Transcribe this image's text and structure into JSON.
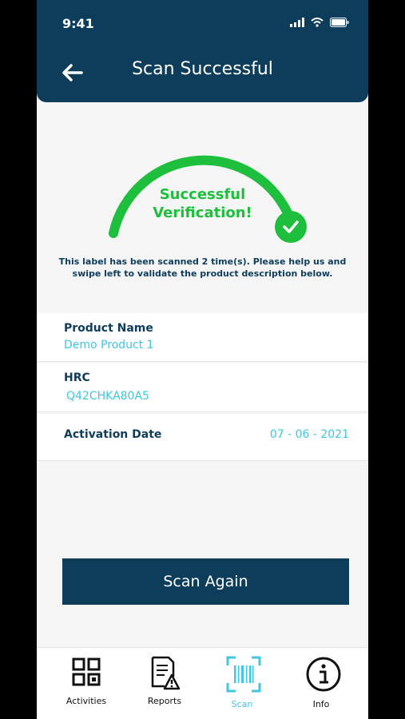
{
  "status_bar": {
    "time": "9:41"
  },
  "header": {
    "title": "Scan Successful"
  },
  "verification": {
    "line1": "Successful",
    "line2": "Verification!",
    "message_line1": "This label has been scanned 2 time(s). Please help us and",
    "message_line2": "swipe left to validate the product description below."
  },
  "fields": {
    "product_name": {
      "label": "Product Name",
      "value": "Demo Product 1"
    },
    "hrc": {
      "label": "HRC",
      "value": "Q42CHKA80A5"
    },
    "activation_date": {
      "label": "Activation Date",
      "value": "07 - 06 - 2021"
    }
  },
  "actions": {
    "scan_again": "Scan Again"
  },
  "tabs": [
    {
      "label": "Activities",
      "icon": "grid-icon"
    },
    {
      "label": "Reports",
      "icon": "report-warning-icon"
    },
    {
      "label": "Scan",
      "icon": "barcode-scan-icon",
      "active": true
    },
    {
      "label": "Info",
      "icon": "info-icon"
    }
  ],
  "colors": {
    "primary": "#0e3d5b",
    "success": "#1dbf3c",
    "accent": "#3fc6e0",
    "background": "#f5f5f5"
  }
}
